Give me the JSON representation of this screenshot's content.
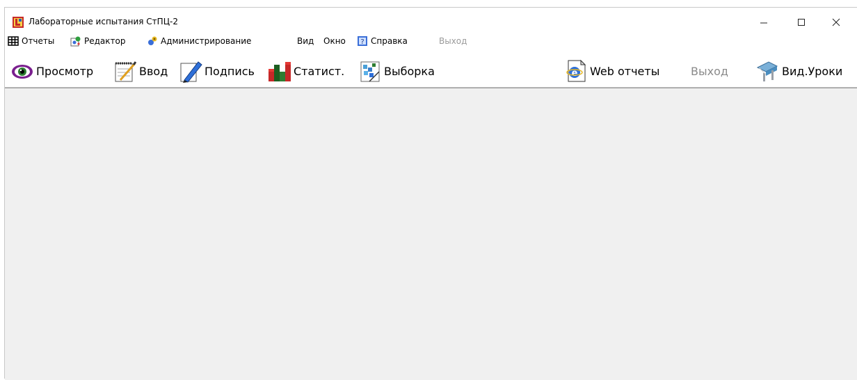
{
  "window": {
    "title": "Лабораторные испытания СтПЦ-2",
    "controls": {
      "minimize": "—",
      "maximize": "☐",
      "close": "✕"
    }
  },
  "menubar": {
    "items": [
      {
        "label": "Отчеты",
        "icon": "table-icon",
        "enabled": true
      },
      {
        "label": "Редактор",
        "icon": "editor-icon",
        "enabled": true
      },
      {
        "label": "Администрирование",
        "icon": "admin-icon",
        "enabled": true
      },
      {
        "label": "Вид",
        "icon": "",
        "enabled": true
      },
      {
        "label": "Окно",
        "icon": "",
        "enabled": true
      },
      {
        "label": "Справка",
        "icon": "help-book-icon",
        "enabled": true
      },
      {
        "label": "Выход",
        "icon": "",
        "enabled": false
      }
    ]
  },
  "toolbar": {
    "items": [
      {
        "label": "Просмотр",
        "icon": "eye-icon",
        "enabled": true
      },
      {
        "label": "Ввод",
        "icon": "notepad-pen-icon",
        "enabled": true
      },
      {
        "label": "Подпись",
        "icon": "signature-pen-icon",
        "enabled": true
      },
      {
        "label": "Статист.",
        "icon": "bar-chart-icon",
        "enabled": true
      },
      {
        "label": "Выборка",
        "icon": "selection-icon",
        "enabled": true
      },
      {
        "label": "Web отчеты",
        "icon": "web-document-icon",
        "enabled": true
      },
      {
        "label": "Выход",
        "icon": "",
        "enabled": false
      },
      {
        "label": "Вид.Уроки",
        "icon": "video-lessons-icon",
        "enabled": true
      }
    ]
  },
  "colors": {
    "client_background": "#f0f0f0",
    "disabled_text": "#9a9a9a"
  }
}
